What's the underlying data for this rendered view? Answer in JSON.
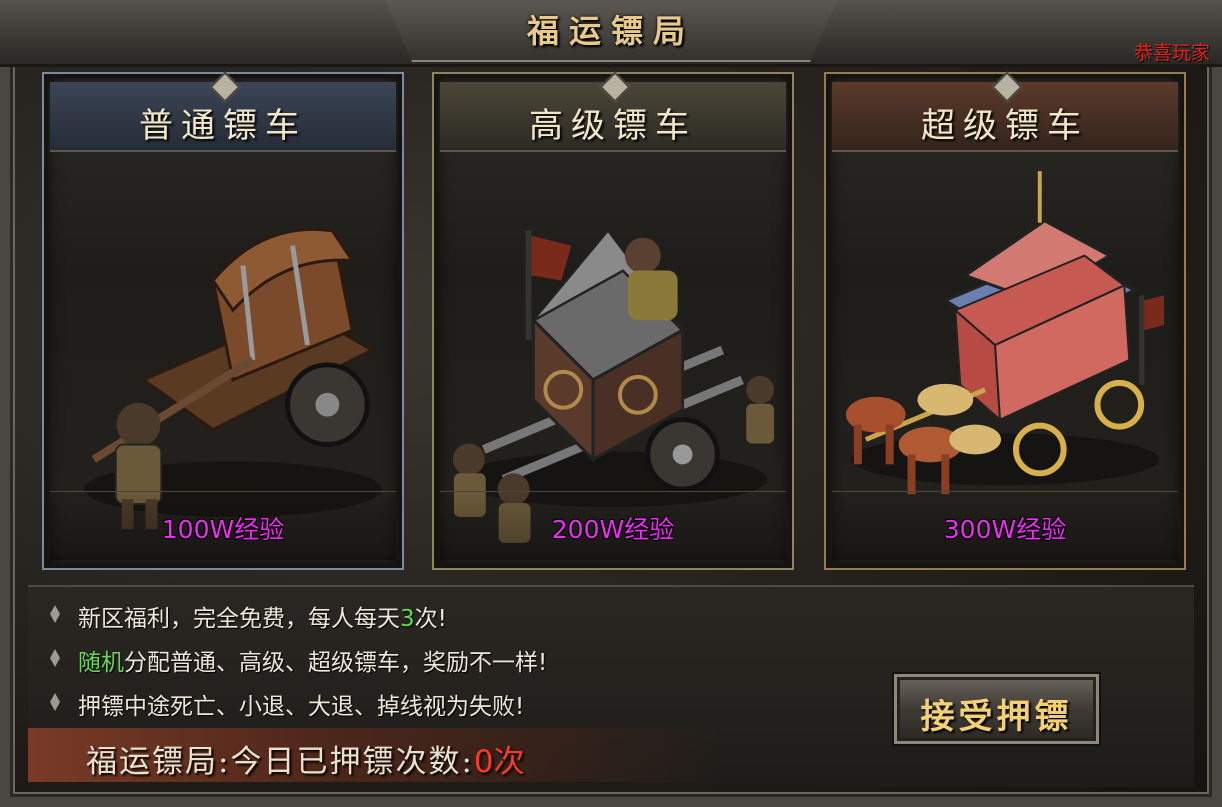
{
  "window": {
    "title": "福运镖局",
    "corner_label": "恭喜玩家"
  },
  "cards": [
    {
      "title": "普通镖车",
      "reward": "100W经验",
      "art_icon": "ox-cart-icon"
    },
    {
      "title": "高级镖车",
      "reward": "200W经验",
      "art_icon": "armored-cart-icon"
    },
    {
      "title": "超级镖车",
      "reward": "300W经验",
      "art_icon": "royal-carriage-icon"
    }
  ],
  "info": {
    "line1_a": "新区福利，完全免费，每人每天",
    "line1_count": "3",
    "line1_b": "次!",
    "line2_word": "随机",
    "line2_rest": "分配普通、高级、超级镖车，奖励不一样!",
    "line3": "押镖中途死亡、小退、大退、掉线视为失败!"
  },
  "accept_button": {
    "label": "接受押镖"
  },
  "status": {
    "label": "福运镖局:今日已押镖次数:",
    "value": "0次"
  },
  "colors": {
    "reward": "#ee2cf3",
    "title_gold": "#e8c98a",
    "highlight_green": "#58e04a",
    "status_red": "#ff3a24",
    "corner_red": "#e0231c"
  }
}
